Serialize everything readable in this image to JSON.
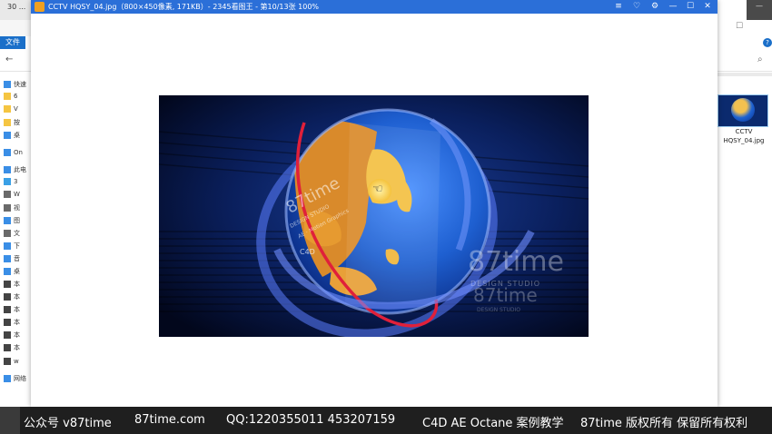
{
  "explorer": {
    "title_fragment": "30 ...",
    "file_tab": "文件",
    "sidebar": [
      "快速",
      "6",
      "V",
      "按",
      "桌",
      "On",
      "此电",
      "3",
      "W",
      "视",
      "图",
      "文",
      "下",
      "音",
      "桌",
      "本",
      "本",
      "本",
      "本",
      "本",
      "本",
      "w",
      "网络"
    ],
    "thumbnail_label": "CCTV HQSY_04.jpg"
  },
  "viewer": {
    "title": "CCTV HQSY_04.jpg（800×450像素, 171KB）- 2345看图王 - 第10/13张 100%",
    "buttons": {
      "menu": "≡",
      "skin": "♡",
      "settings": "⚙",
      "minimize": "—",
      "maximize": "☐",
      "close": "✕"
    }
  },
  "image": {
    "watermark_main": "87time",
    "watermark_sub": "DESIGN STUDIO",
    "watermark_main2": "87time",
    "watermark_sub2": "DESIGN STUDIO",
    "globe_text_1": "87time",
    "globe_text_2": "DESIGN STUDIO",
    "globe_text_3": "AE · Motion Graphics",
    "globe_text_4": "C4D"
  },
  "caption": {
    "wechat": "公众号 v87time",
    "site": "87time.com",
    "qq": "QQ:1220355011   453207159",
    "course": "C4D AE Octane 案例教学",
    "copyright": "87time 版权所有  保留所有权利"
  },
  "colors": {
    "viewer_titlebar": "#2b6fd8",
    "caption_bg": "#1f1f1f",
    "globe_ocean": "#1e63d3",
    "globe_land": "#f3b540",
    "orbit_red": "#e0203a"
  }
}
